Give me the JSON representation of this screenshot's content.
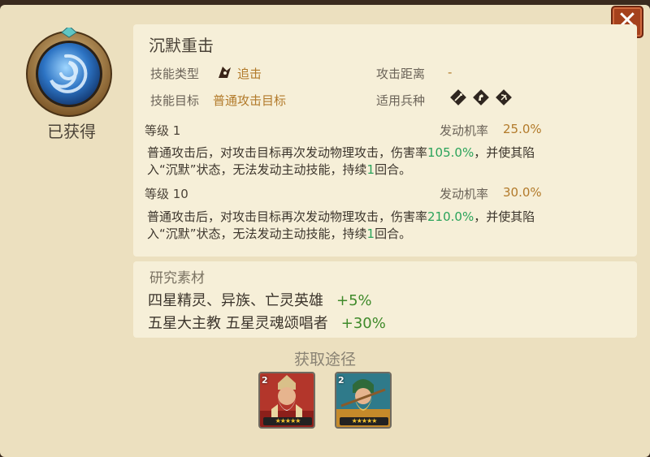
{
  "dialog": {
    "close_label": "✕",
    "status_label": "已获得"
  },
  "skill": {
    "name": "沉默重击",
    "type_label": "技能类型",
    "type_value": "追击",
    "range_label": "攻击距离",
    "range_value": "-",
    "target_label": "技能目标",
    "target_value": "普通攻击目标",
    "units_label": "适用兵种",
    "unit_icons": [
      "infantry-icon",
      "cavalry-icon",
      "archer-icon"
    ]
  },
  "levels": [
    {
      "level_label": "等级 1",
      "rate_label": "发动机率",
      "rate_value": "25.0%",
      "desc_a": "普通攻击后，对攻击目标再次发动物理攻击，伤害率",
      "desc_pct": "105.0%",
      "desc_b": "，并使其陷",
      "desc_c": "入“沉默”状态，无法发动主动技能，持续",
      "desc_n": "1",
      "desc_d": "回合。"
    },
    {
      "level_label": "等级 10",
      "rate_label": "发动机率",
      "rate_value": "30.0%",
      "desc_a": "普通攻击后，对攻击目标再次发动物理攻击，伤害率",
      "desc_pct": "210.0%",
      "desc_b": "，并使其陷",
      "desc_c": "入“沉默”状态，无法发动主动技能，持续",
      "desc_n": "1",
      "desc_d": "回合。"
    }
  ],
  "research": {
    "title": "研究素材",
    "rows": [
      {
        "text": "四星精灵、异族、亡灵英雄",
        "bonus": "+5%"
      },
      {
        "text": "五星大主教 五星灵魂颂唱者",
        "bonus": "+30%"
      }
    ]
  },
  "source": {
    "title": "获取途径",
    "heroes": [
      {
        "badge": "2",
        "stars": "★★★★★"
      },
      {
        "badge": "2",
        "stars": "★★★★★"
      }
    ]
  },
  "colors": {
    "accent_gold": "#b27a2a",
    "green": "#2aa35a",
    "close_bg": "#a5411c"
  }
}
